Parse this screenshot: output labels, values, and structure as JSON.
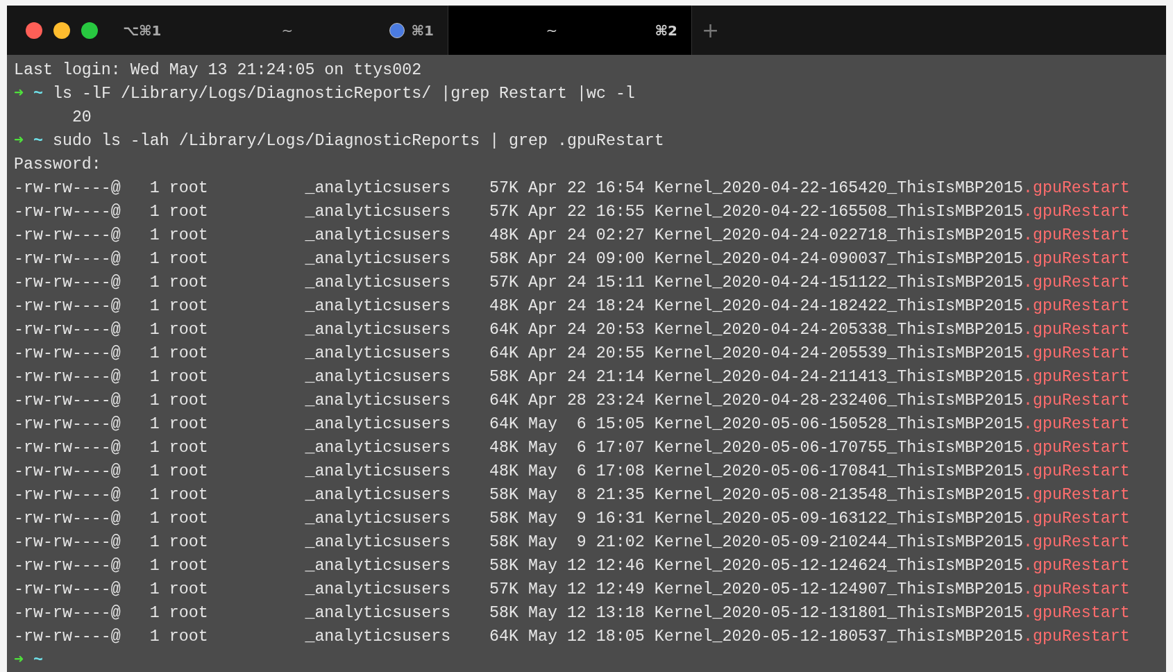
{
  "window": {
    "shortcut": "⌥⌘1",
    "new_tab": "+"
  },
  "tabs": [
    {
      "title": "~",
      "shortcut": "⌘1",
      "dot": true,
      "selected": false
    },
    {
      "title": "~",
      "shortcut": "⌘2",
      "dot": false,
      "selected": true
    }
  ],
  "lines": [
    {
      "kind": "text",
      "text": "Last login: Wed May 13 21:24:05 on ttys002"
    },
    {
      "kind": "prompt",
      "arrow": "➜",
      "dir": "~",
      "command": "ls -lF /Library/Logs/DiagnosticReports/ |grep Restart |wc -l"
    },
    {
      "kind": "text",
      "text": "      20"
    },
    {
      "kind": "prompt",
      "arrow": "➜",
      "dir": "~",
      "command": "sudo ls -lah /Library/Logs/DiagnosticReports | grep .gpuRestart"
    },
    {
      "kind": "text",
      "text": "Password:"
    },
    {
      "kind": "file",
      "text": "-rw-rw----@   1 root          _analyticsusers    57K Apr 22 16:54 Kernel_2020-04-22-165420_ThisIsMBP2015",
      "ext": ".gpuRestart"
    },
    {
      "kind": "file",
      "text": "-rw-rw----@   1 root          _analyticsusers    57K Apr 22 16:55 Kernel_2020-04-22-165508_ThisIsMBP2015",
      "ext": ".gpuRestart"
    },
    {
      "kind": "file",
      "text": "-rw-rw----@   1 root          _analyticsusers    48K Apr 24 02:27 Kernel_2020-04-24-022718_ThisIsMBP2015",
      "ext": ".gpuRestart"
    },
    {
      "kind": "file",
      "text": "-rw-rw----@   1 root          _analyticsusers    58K Apr 24 09:00 Kernel_2020-04-24-090037_ThisIsMBP2015",
      "ext": ".gpuRestart"
    },
    {
      "kind": "file",
      "text": "-rw-rw----@   1 root          _analyticsusers    57K Apr 24 15:11 Kernel_2020-04-24-151122_ThisIsMBP2015",
      "ext": ".gpuRestart"
    },
    {
      "kind": "file",
      "text": "-rw-rw----@   1 root          _analyticsusers    48K Apr 24 18:24 Kernel_2020-04-24-182422_ThisIsMBP2015",
      "ext": ".gpuRestart"
    },
    {
      "kind": "file",
      "text": "-rw-rw----@   1 root          _analyticsusers    64K Apr 24 20:53 Kernel_2020-04-24-205338_ThisIsMBP2015",
      "ext": ".gpuRestart"
    },
    {
      "kind": "file",
      "text": "-rw-rw----@   1 root          _analyticsusers    64K Apr 24 20:55 Kernel_2020-04-24-205539_ThisIsMBP2015",
      "ext": ".gpuRestart"
    },
    {
      "kind": "file",
      "text": "-rw-rw----@   1 root          _analyticsusers    58K Apr 24 21:14 Kernel_2020-04-24-211413_ThisIsMBP2015",
      "ext": ".gpuRestart"
    },
    {
      "kind": "file",
      "text": "-rw-rw----@   1 root          _analyticsusers    64K Apr 28 23:24 Kernel_2020-04-28-232406_ThisIsMBP2015",
      "ext": ".gpuRestart"
    },
    {
      "kind": "file",
      "text": "-rw-rw----@   1 root          _analyticsusers    64K May  6 15:05 Kernel_2020-05-06-150528_ThisIsMBP2015",
      "ext": ".gpuRestart"
    },
    {
      "kind": "file",
      "text": "-rw-rw----@   1 root          _analyticsusers    48K May  6 17:07 Kernel_2020-05-06-170755_ThisIsMBP2015",
      "ext": ".gpuRestart"
    },
    {
      "kind": "file",
      "text": "-rw-rw----@   1 root          _analyticsusers    48K May  6 17:08 Kernel_2020-05-06-170841_ThisIsMBP2015",
      "ext": ".gpuRestart"
    },
    {
      "kind": "file",
      "text": "-rw-rw----@   1 root          _analyticsusers    58K May  8 21:35 Kernel_2020-05-08-213548_ThisIsMBP2015",
      "ext": ".gpuRestart"
    },
    {
      "kind": "file",
      "text": "-rw-rw----@   1 root          _analyticsusers    58K May  9 16:31 Kernel_2020-05-09-163122_ThisIsMBP2015",
      "ext": ".gpuRestart"
    },
    {
      "kind": "file",
      "text": "-rw-rw----@   1 root          _analyticsusers    58K May  9 21:02 Kernel_2020-05-09-210244_ThisIsMBP2015",
      "ext": ".gpuRestart"
    },
    {
      "kind": "file",
      "text": "-rw-rw----@   1 root          _analyticsusers    58K May 12 12:46 Kernel_2020-05-12-124624_ThisIsMBP2015",
      "ext": ".gpuRestart"
    },
    {
      "kind": "file",
      "text": "-rw-rw----@   1 root          _analyticsusers    57K May 12 12:49 Kernel_2020-05-12-124907_ThisIsMBP2015",
      "ext": ".gpuRestart"
    },
    {
      "kind": "file",
      "text": "-rw-rw----@   1 root          _analyticsusers    58K May 12 13:18 Kernel_2020-05-12-131801_ThisIsMBP2015",
      "ext": ".gpuRestart"
    },
    {
      "kind": "file",
      "text": "-rw-rw----@   1 root          _analyticsusers    64K May 12 18:05 Kernel_2020-05-12-180537_ThisIsMBP2015",
      "ext": ".gpuRestart"
    },
    {
      "kind": "prompt",
      "arrow": "➜",
      "dir": "~"
    }
  ]
}
